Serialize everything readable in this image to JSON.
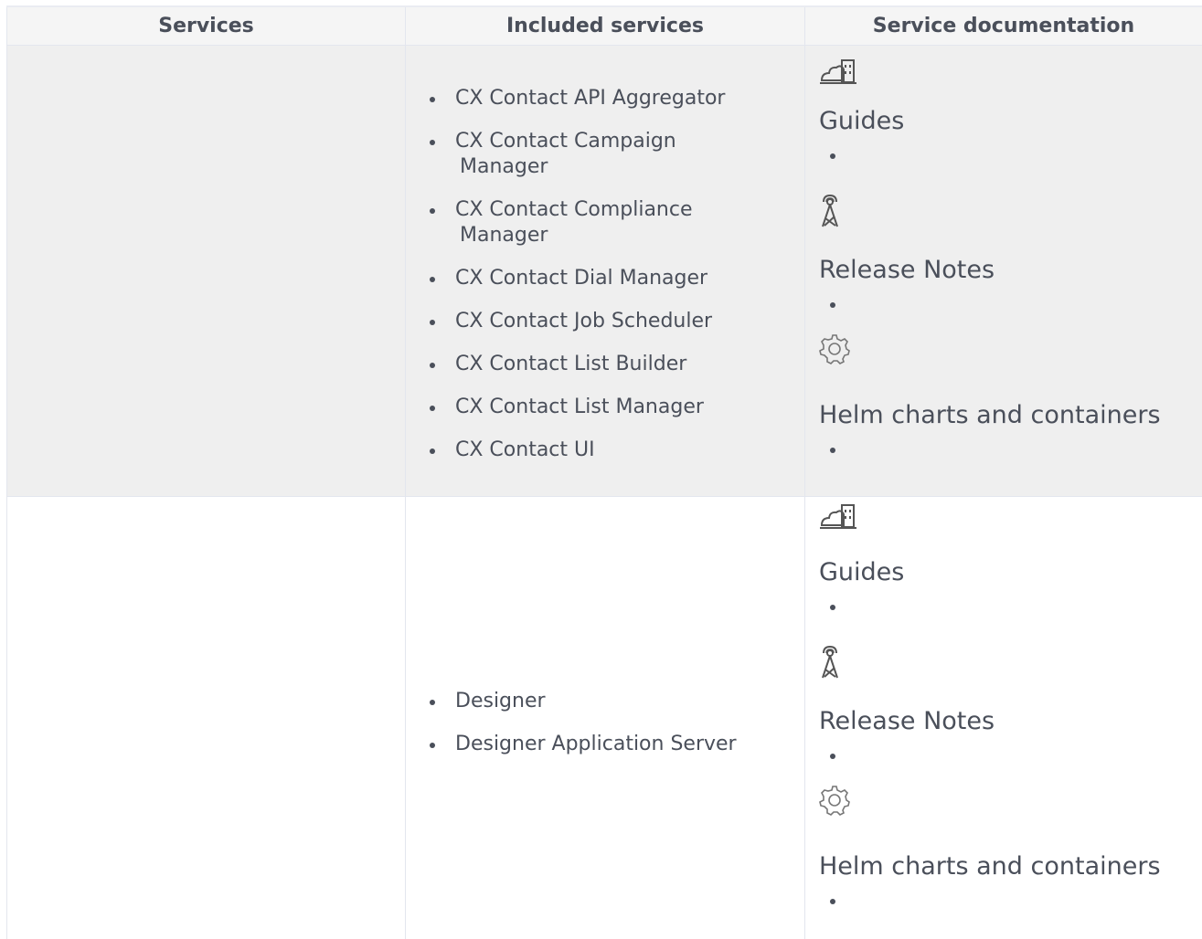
{
  "table": {
    "headers": [
      "Services",
      "Included services",
      "Service documentation"
    ],
    "rows": [
      {
        "service": "",
        "included": [
          "CX Contact API Aggregator",
          "CX Contact Campaign",
          "Manager",
          "CX Contact Compliance",
          "Manager",
          "CX Contact Dial Manager",
          "CX Contact Job Scheduler",
          "CX Contact List Builder",
          "CX Contact List Manager",
          "CX Contact UI"
        ],
        "docs": [
          {
            "icon": "building-cloud-icon",
            "title": "Guides"
          },
          {
            "icon": "antenna-tower-icon",
            "title": "Release Notes"
          },
          {
            "icon": "gear-icon",
            "title": "Helm charts and containers"
          }
        ]
      },
      {
        "service": "",
        "included": [
          "Designer",
          "Designer Application Server"
        ],
        "docs": [
          {
            "icon": "building-cloud-icon",
            "title": "Guides"
          },
          {
            "icon": "antenna-tower-icon",
            "title": "Release Notes"
          },
          {
            "icon": "gear-icon",
            "title": "Helm charts and containers"
          }
        ]
      }
    ]
  },
  "colors": {
    "text": "#4a4f5a",
    "shaded_row": "#efefef",
    "border": "#e3e6ee"
  }
}
